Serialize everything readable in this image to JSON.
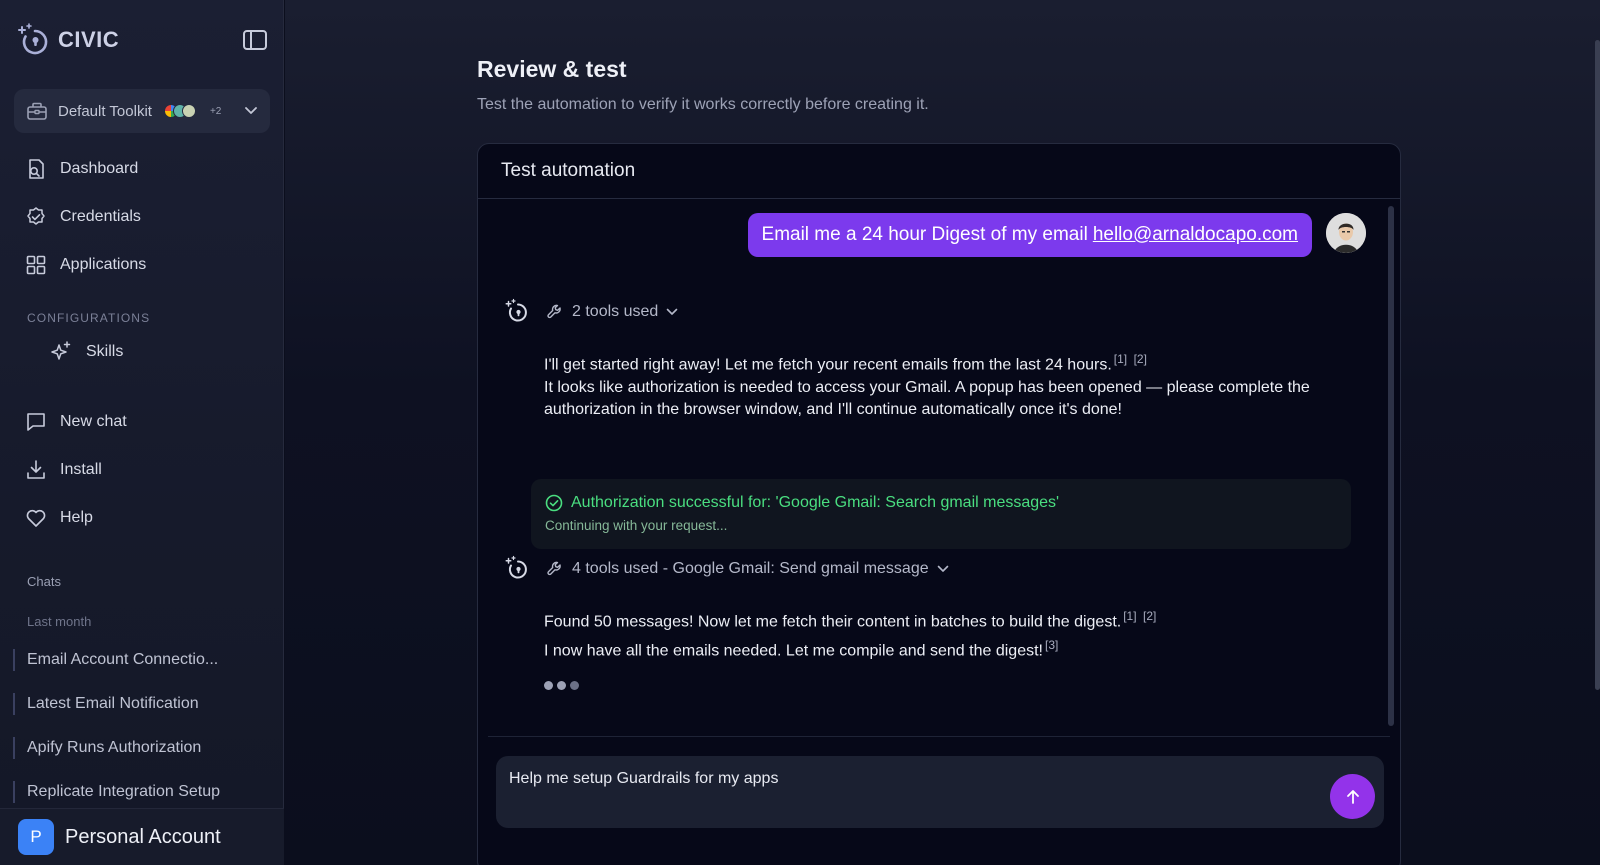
{
  "brand": {
    "name": "CIVIC"
  },
  "toolkit": {
    "label": "Default Toolkit",
    "more": "+2"
  },
  "nav": {
    "dashboard": "Dashboard",
    "credentials": "Credentials",
    "applications": "Applications"
  },
  "configurations": {
    "label": "CONFIGURATIONS",
    "skills": "Skills"
  },
  "actions": {
    "new_chat": "New chat",
    "install": "Install",
    "help": "Help"
  },
  "chats": {
    "label": "Chats",
    "group": "Last month",
    "items": [
      "Email Account Connectio...",
      "Latest Email Notification",
      "Apify Runs Authorization",
      "Replicate Integration Setup"
    ]
  },
  "account": {
    "initial": "P",
    "name": "Personal Account"
  },
  "page": {
    "title": "Review & test",
    "subtitle": "Test the automation to verify it works correctly before creating it."
  },
  "test": {
    "header": "Test automation",
    "user_message": {
      "text": "Email me a 24 hour Digest of my email",
      "link": "hello@arnaldocapo.com"
    },
    "turn1": {
      "tools": "2 tools used",
      "line1": "I'll get started right away! Let me fetch your recent emails from the last 24 hours.",
      "cite1": "[1]",
      "cite2": "[2]",
      "line2": "It looks like authorization is needed to access your Gmail. A popup has been opened — please complete the authorization in the browser window, and I'll continue automatically once it's done!"
    },
    "auth": {
      "title": "Authorization successful for: 'Google Gmail: Search gmail messages'",
      "subtitle": "Continuing with your request..."
    },
    "turn2": {
      "tools": "4 tools used - Google Gmail: Send gmail message",
      "line1": "Found 50 messages! Now let me fetch their content in batches to build the digest.",
      "cite1": "[1]",
      "cite2": "[2]",
      "line2": "I now have all the emails needed. Let me compile and send the digest!",
      "cite3": "[3]"
    },
    "composer": {
      "value": "Help me setup Guardrails for my apps"
    }
  },
  "colors": {
    "accent_purple": "#7c3aed",
    "send_button": "#9333ea",
    "success_green": "#4ade80",
    "account_blue": "#3b82f6"
  },
  "icons": {
    "brand": "civic-logo-icon",
    "collapse": "sidebar-toggle-icon",
    "toolkit": "toolbox-icon",
    "dashboard": "dashboard-icon",
    "credentials": "shield-check-icon",
    "applications": "grid-icon",
    "skills": "sparkle-icon",
    "new_chat": "chat-bubble-icon",
    "install": "download-icon",
    "help": "heart-icon",
    "tools": "wrench-icon",
    "success": "check-circle-icon",
    "send": "arrow-up-icon"
  }
}
